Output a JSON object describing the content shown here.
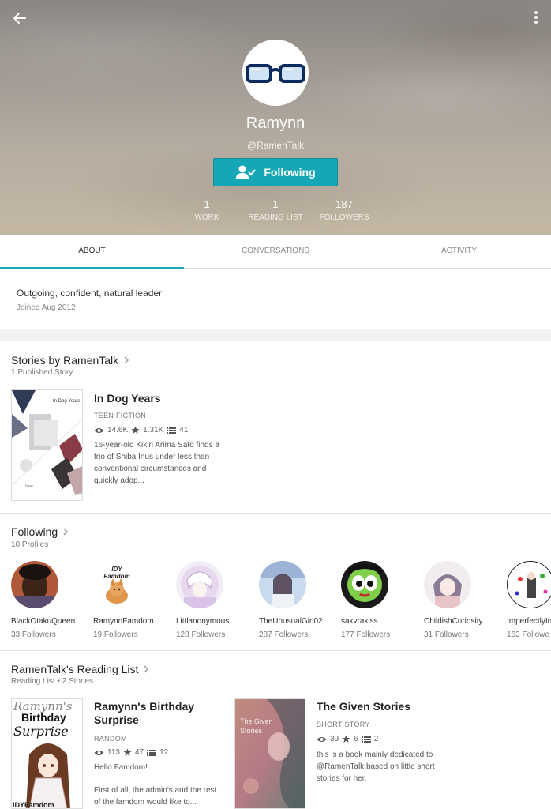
{
  "profile": {
    "name": "Ramynn",
    "handle": "@RamenTalk",
    "follow_label": "Following",
    "accent": "#16a7b6"
  },
  "stats": [
    {
      "value": "1",
      "label": "WORK"
    },
    {
      "value": "1",
      "label": "READING LIST"
    },
    {
      "value": "187",
      "label": "FOLLOWERS"
    }
  ],
  "tabs": [
    {
      "label": "ABOUT",
      "active": true
    },
    {
      "label": "CONVERSATIONS",
      "active": false
    },
    {
      "label": "ACTIVITY",
      "active": false
    }
  ],
  "about": {
    "description": "Outgoing, confident, natural leader",
    "joined": "Joined Aug 2012"
  },
  "stories_section": {
    "title": "Stories by RamenTalk",
    "subtitle": "1 Published Story",
    "story": {
      "cover_title": "In Dog Years",
      "cover_author": "Jane",
      "title": "In Dog Years",
      "category": "TEEN FICTION",
      "reads": "14.6K",
      "votes": "1.31K",
      "parts": "41",
      "desc": "16-year-old Kikiri Arima Sato finds a trio of Shiba Inus under less than conventional circumstances and quickly adop..."
    }
  },
  "following_section": {
    "title": "Following",
    "subtitle": "10 Profiles",
    "profiles": [
      {
        "name": "BlackOtakuQueen",
        "followers": "33 Followers"
      },
      {
        "name": "RamynnFamdom",
        "followers": "19 Followers"
      },
      {
        "name": "Littlanonymous",
        "followers": "128 Followers"
      },
      {
        "name": "TheUnusualGirl02",
        "followers": "287 Followers"
      },
      {
        "name": "sakvrakiss",
        "followers": "177 Followers"
      },
      {
        "name": "ChildishCuriosity",
        "followers": "31 Followers"
      },
      {
        "name": "ImperfectlyIn",
        "followers": "163 Followe"
      }
    ],
    "famdom_logo_text": "IDY Famdom"
  },
  "reading_section": {
    "title": "RamenTalk's Reading List",
    "subtitle": "Reading List • 2 Stories",
    "stories": [
      {
        "cover_text_1": "Ramynn's",
        "cover_text_2": "Birthday",
        "cover_text_3": "Surprise",
        "cover_footer": "IDYFamdom",
        "title": "Ramynn's Birthday Surprise",
        "category": "RANDOM",
        "reads": "113",
        "votes": "47",
        "parts": "12",
        "desc1": "Hello Famdom!",
        "desc2": "First of all, the admin's and the rest of the famdom would like to..."
      },
      {
        "cover_text": "The Given Stories",
        "title": "The Given Stories",
        "category": "SHORT STORY",
        "reads": "39",
        "votes": "6",
        "parts": "2",
        "desc": "this is a book mainly dedicated to @RamenTalk based on little short stories for her."
      }
    ]
  }
}
